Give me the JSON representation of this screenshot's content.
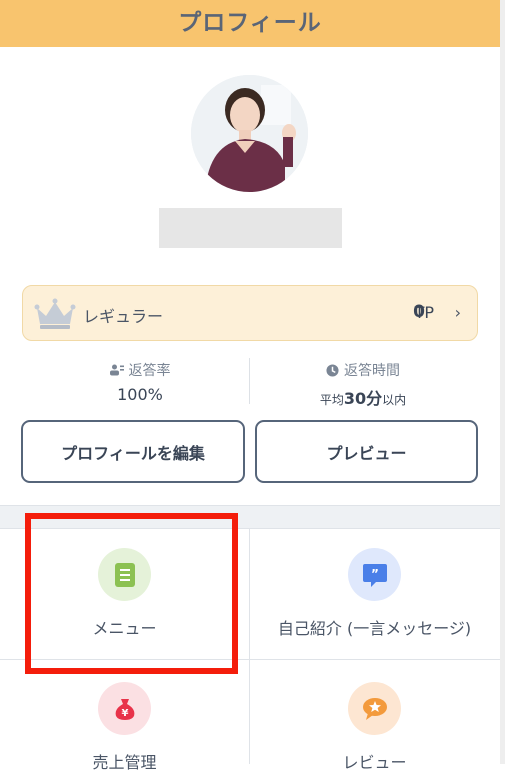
{
  "header": {
    "title": "プロフィール"
  },
  "rank": {
    "label": "レギュラー",
    "tp_value": "0",
    "tp_unit": "TP"
  },
  "stats": {
    "response_rate": {
      "label": "返答率",
      "value": "100%"
    },
    "response_time": {
      "label": "返答時間",
      "prefix": "平均",
      "value": "30分",
      "suffix": "以内"
    }
  },
  "buttons": {
    "edit": "プロフィールを編集",
    "preview": "プレビュー"
  },
  "menu": [
    {
      "label": "メニュー",
      "icon": "list-icon",
      "color": "#8cc152"
    },
    {
      "label": "自己紹介 (一言メッセージ)",
      "icon": "quote-bubble-icon",
      "color": "#4a7fe8"
    },
    {
      "label": "売上管理",
      "icon": "money-bag-icon",
      "color": "#e8334a"
    },
    {
      "label": "レビュー",
      "icon": "star-bubble-icon",
      "color": "#f39a3c"
    }
  ],
  "colors": {
    "header": "#f8c46e",
    "highlight": "#f41d0b"
  }
}
